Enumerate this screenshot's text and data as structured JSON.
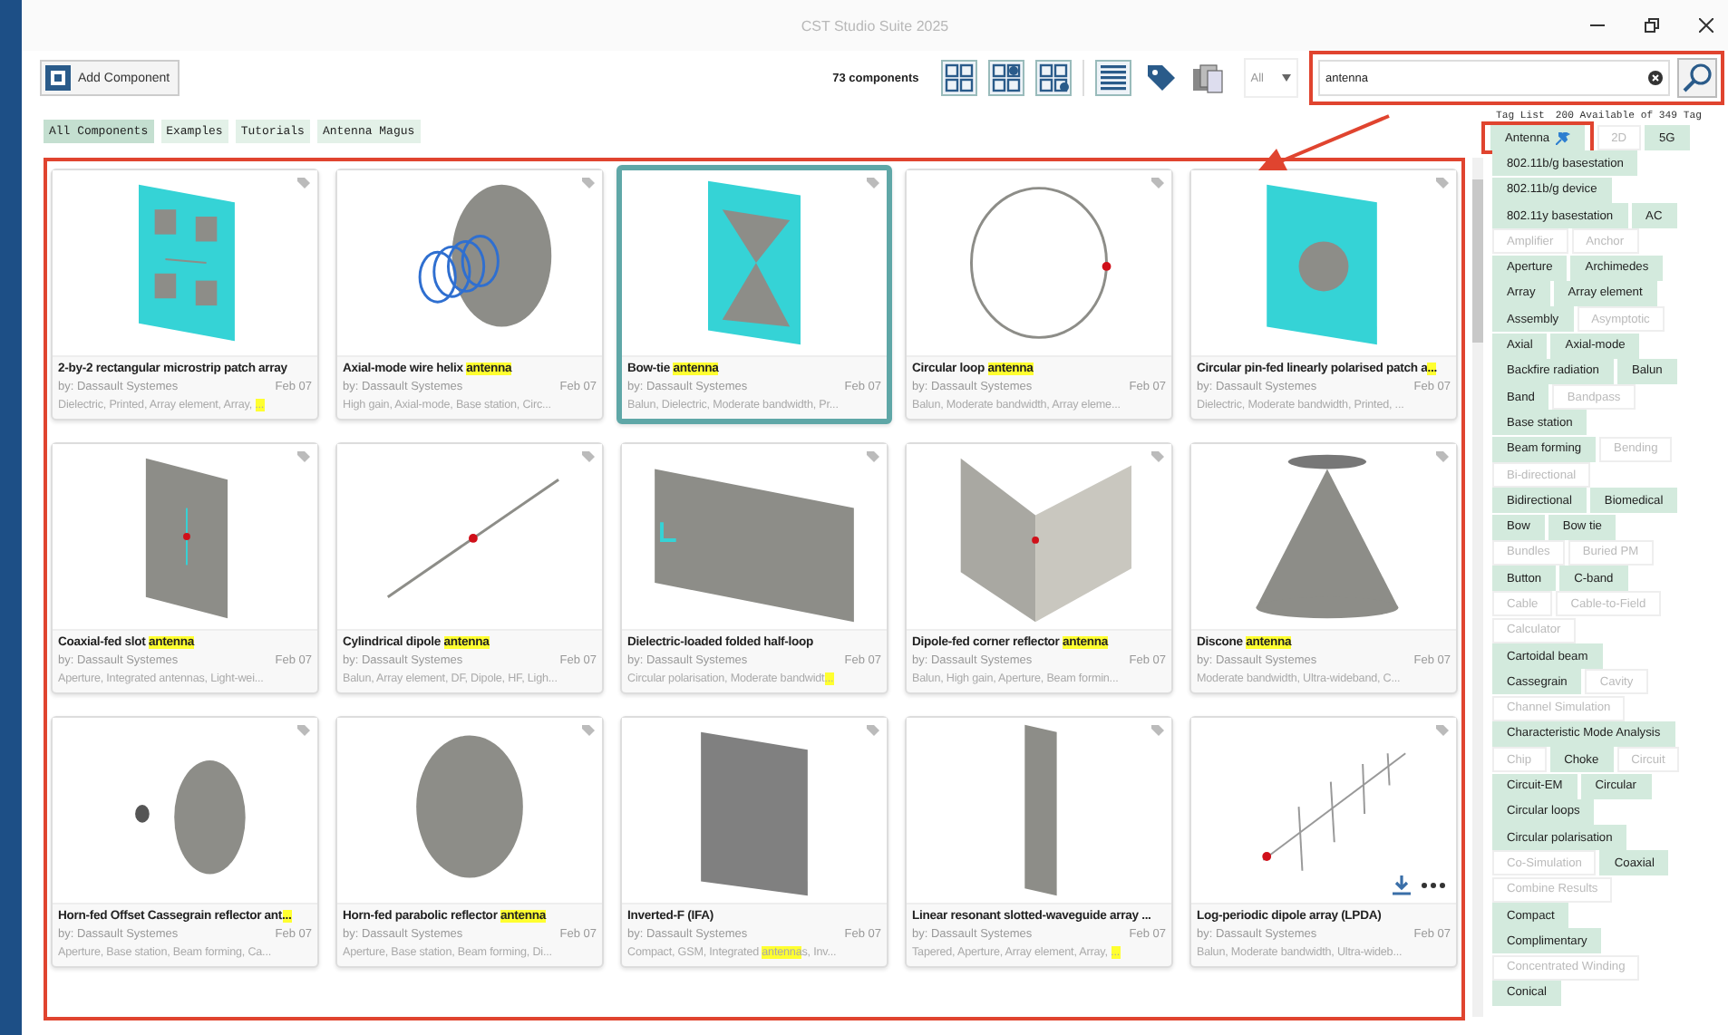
{
  "window": {
    "title": "CST Studio Suite 2025"
  },
  "toolbar": {
    "add_button": "Add Component",
    "count": "73 components",
    "filter": "All",
    "search": {
      "value": "antenna"
    }
  },
  "filters": [
    {
      "label": "All Components",
      "selected": true
    },
    {
      "label": "Examples",
      "selected": false
    },
    {
      "label": "Tutorials",
      "selected": false
    },
    {
      "label": "Antenna Magus",
      "selected": false
    }
  ],
  "cards": [
    {
      "kind": "patch-array",
      "selected": false,
      "hovered": false,
      "title": [
        {
          "text": "2-by-2 rectangular microstrip patch array",
          "highlight": false
        }
      ],
      "author": "by: Dassault Systemes",
      "date": "Feb 07",
      "tags": [
        {
          "text": "Dielectric, Printed, Array element, Array, ",
          "highlight": false
        },
        {
          "text": "...",
          "highlight": true
        }
      ]
    },
    {
      "kind": "helix",
      "selected": false,
      "hovered": false,
      "title": [
        {
          "text": "Axial-mode wire helix ",
          "highlight": false
        },
        {
          "text": "antenna",
          "highlight": true
        }
      ],
      "author": "by: Dassault Systemes",
      "date": "Feb 07",
      "tags": [
        {
          "text": "High gain, Axial-mode, Base station, Circ...",
          "highlight": false
        }
      ]
    },
    {
      "kind": "bowtie",
      "selected": true,
      "hovered": false,
      "title": [
        {
          "text": "Bow-tie ",
          "highlight": false
        },
        {
          "text": "antenna",
          "highlight": true
        }
      ],
      "author": "by: Dassault Systemes",
      "date": "Feb 07",
      "tags": [
        {
          "text": "Balun, Dielectric, Moderate bandwidth, Pr...",
          "highlight": false
        }
      ]
    },
    {
      "kind": "loop",
      "selected": false,
      "hovered": false,
      "title": [
        {
          "text": "Circular loop ",
          "highlight": false
        },
        {
          "text": "antenna",
          "highlight": true
        }
      ],
      "author": "by: Dassault Systemes",
      "date": "Feb 07",
      "tags": [
        {
          "text": "Balun, Moderate bandwidth, Array eleme...",
          "highlight": false
        }
      ]
    },
    {
      "kind": "patch-disc",
      "selected": false,
      "hovered": false,
      "title": [
        {
          "text": "Circular pin-fed linearly polarised patch a",
          "highlight": false
        },
        {
          "text": "...",
          "highlight": true
        }
      ],
      "author": "by: Dassault Systemes",
      "date": "Feb 07",
      "tags": [
        {
          "text": "Dielectric, Moderate bandwidth, Printed, ...",
          "highlight": false
        }
      ]
    },
    {
      "kind": "slot",
      "selected": false,
      "hovered": false,
      "title": [
        {
          "text": "Coaxial-fed slot ",
          "highlight": false
        },
        {
          "text": "antenna",
          "highlight": true
        }
      ],
      "author": "by: Dassault Systemes",
      "date": "Feb 07",
      "tags": [
        {
          "text": "Aperture, Integrated antennas, Light-wei...",
          "highlight": false
        }
      ]
    },
    {
      "kind": "dipole",
      "selected": false,
      "hovered": false,
      "title": [
        {
          "text": "Cylindrical dipole ",
          "highlight": false
        },
        {
          "text": "antenna",
          "highlight": true
        }
      ],
      "author": "by: Dassault Systemes",
      "date": "Feb 07",
      "tags": [
        {
          "text": "Balun, Array element, DF, Dipole, HF, Ligh...",
          "highlight": false
        }
      ]
    },
    {
      "kind": "plate",
      "selected": false,
      "hovered": false,
      "title": [
        {
          "text": "Dielectric-loaded folded half-loop",
          "highlight": false
        }
      ],
      "author": "by: Dassault Systemes",
      "date": "Feb 07",
      "tags": [
        {
          "text": "Circular polarisation, Moderate bandwidt",
          "highlight": false
        },
        {
          "text": "...",
          "highlight": true
        }
      ]
    },
    {
      "kind": "corner",
      "selected": false,
      "hovered": false,
      "title": [
        {
          "text": "Dipole-fed corner reflector ",
          "highlight": false
        },
        {
          "text": "antenna",
          "highlight": true
        }
      ],
      "author": "by: Dassault Systemes",
      "date": "Feb 07",
      "tags": [
        {
          "text": "Balun, High gain, Aperture, Beam formin...",
          "highlight": false
        }
      ]
    },
    {
      "kind": "cone",
      "selected": false,
      "hovered": false,
      "title": [
        {
          "text": "Discone ",
          "highlight": false
        },
        {
          "text": "antenna",
          "highlight": true
        }
      ],
      "author": "by: Dassault Systemes",
      "date": "Feb 07",
      "tags": [
        {
          "text": "Moderate bandwidth, Ultra-wideband, C...",
          "highlight": false
        }
      ]
    },
    {
      "kind": "cassegrain",
      "selected": false,
      "hovered": false,
      "title": [
        {
          "text": "Horn-fed Offset Cassegrain reflector ant",
          "highlight": false
        },
        {
          "text": "...",
          "highlight": true
        }
      ],
      "author": "by: Dassault Systemes",
      "date": "Feb 07",
      "tags": [
        {
          "text": "Aperture, Base station, Beam forming, Ca...",
          "highlight": false
        }
      ]
    },
    {
      "kind": "dish",
      "selected": false,
      "hovered": false,
      "title": [
        {
          "text": "Horn-fed parabolic reflector ",
          "highlight": false
        },
        {
          "text": "antenna",
          "highlight": true
        }
      ],
      "author": "by: Dassault Systemes",
      "date": "Feb 07",
      "tags": [
        {
          "text": "Aperture, Base station, Beam forming, Di...",
          "highlight": false
        }
      ]
    },
    {
      "kind": "panel",
      "selected": false,
      "hovered": false,
      "title": [
        {
          "text": "Inverted-F (IFA)",
          "highlight": false
        }
      ],
      "author": "by: Dassault Systemes",
      "date": "Feb 07",
      "tags": [
        {
          "text": "Compact, GSM, Integrated ",
          "highlight": false
        },
        {
          "text": "antenna",
          "highlight": true
        },
        {
          "text": "s, Inv...",
          "highlight": false
        }
      ]
    },
    {
      "kind": "rod",
      "selected": false,
      "hovered": false,
      "title": [
        {
          "text": "Linear resonant slotted-waveguide array ...",
          "highlight": false
        }
      ],
      "author": "by: Dassault Systemes",
      "date": "Feb 07",
      "tags": [
        {
          "text": "Tapered, Aperture, Array element, Array, ",
          "highlight": false
        },
        {
          "text": "...",
          "highlight": true
        }
      ]
    },
    {
      "kind": "lpda",
      "selected": false,
      "hovered": true,
      "title": [
        {
          "text": "Log-periodic dipole array (LPDA)",
          "highlight": false
        }
      ],
      "author": "by: Dassault Systemes",
      "date": "Feb 07",
      "tags": [
        {
          "text": "Balun, Moderate bandwidth, Ultra-wideb...",
          "highlight": false
        }
      ]
    }
  ],
  "tag_panel": {
    "title": "Tag List",
    "summary": "200 Available of 349 Tag",
    "rows": [
      [
        {
          "label": "Antenna",
          "enabled": true,
          "pinned": true
        },
        {
          "label": "2D",
          "enabled": false,
          "pinned": false
        },
        {
          "label": "5G",
          "enabled": true,
          "pinned": false
        }
      ],
      [
        {
          "label": "802.11b/g basestation",
          "enabled": true,
          "pinned": false
        }
      ],
      [
        {
          "label": "802.11b/g device",
          "enabled": true,
          "pinned": false
        }
      ],
      [
        {
          "label": "802.11y basestation",
          "enabled": true,
          "pinned": false
        },
        {
          "label": "AC",
          "enabled": true,
          "pinned": false
        }
      ],
      [
        {
          "label": "Amplifier",
          "enabled": false,
          "pinned": false
        },
        {
          "label": "Anchor",
          "enabled": false,
          "pinned": false
        }
      ],
      [
        {
          "label": "Aperture",
          "enabled": true,
          "pinned": false
        },
        {
          "label": "Archimedes",
          "enabled": true,
          "pinned": false
        }
      ],
      [
        {
          "label": "Array",
          "enabled": true,
          "pinned": false
        },
        {
          "label": "Array element",
          "enabled": true,
          "pinned": false
        }
      ],
      [
        {
          "label": "Assembly",
          "enabled": true,
          "pinned": false
        },
        {
          "label": "Asymptotic",
          "enabled": false,
          "pinned": false
        }
      ],
      [
        {
          "label": "Axial",
          "enabled": true,
          "pinned": false
        },
        {
          "label": "Axial-mode",
          "enabled": true,
          "pinned": false
        }
      ],
      [
        {
          "label": "Backfire radiation",
          "enabled": true,
          "pinned": false
        },
        {
          "label": "Balun",
          "enabled": true,
          "pinned": false
        }
      ],
      [
        {
          "label": "Band",
          "enabled": true,
          "pinned": false
        },
        {
          "label": "Bandpass",
          "enabled": false,
          "pinned": false
        }
      ],
      [
        {
          "label": "Base station",
          "enabled": true,
          "pinned": false
        }
      ],
      [
        {
          "label": "Beam forming",
          "enabled": true,
          "pinned": false
        },
        {
          "label": "Bending",
          "enabled": false,
          "pinned": false
        }
      ],
      [
        {
          "label": "Bi-directional",
          "enabled": false,
          "pinned": false
        }
      ],
      [
        {
          "label": "Bidirectional",
          "enabled": true,
          "pinned": false
        },
        {
          "label": "Biomedical",
          "enabled": true,
          "pinned": false
        }
      ],
      [
        {
          "label": "Bow",
          "enabled": true,
          "pinned": false
        },
        {
          "label": "Bow tie",
          "enabled": true,
          "pinned": false
        }
      ],
      [
        {
          "label": "Bundles",
          "enabled": false,
          "pinned": false
        },
        {
          "label": "Buried PM",
          "enabled": false,
          "pinned": false
        }
      ],
      [
        {
          "label": "Button",
          "enabled": true,
          "pinned": false
        },
        {
          "label": "C-band",
          "enabled": true,
          "pinned": false
        }
      ],
      [
        {
          "label": "Cable",
          "enabled": false,
          "pinned": false
        },
        {
          "label": "Cable-to-Field",
          "enabled": false,
          "pinned": false
        }
      ],
      [
        {
          "label": "Calculator",
          "enabled": false,
          "pinned": false
        }
      ],
      [
        {
          "label": "Cartoidal beam",
          "enabled": true,
          "pinned": false
        }
      ],
      [
        {
          "label": "Cassegrain",
          "enabled": true,
          "pinned": false
        },
        {
          "label": "Cavity",
          "enabled": false,
          "pinned": false
        }
      ],
      [
        {
          "label": "Channel Simulation",
          "enabled": false,
          "pinned": false
        }
      ],
      [
        {
          "label": "Characteristic Mode Analysis",
          "enabled": true,
          "pinned": false
        }
      ],
      [
        {
          "label": "Chip",
          "enabled": false,
          "pinned": false
        },
        {
          "label": "Choke",
          "enabled": true,
          "pinned": false
        },
        {
          "label": "Circuit",
          "enabled": false,
          "pinned": false
        }
      ],
      [
        {
          "label": "Circuit-EM",
          "enabled": true,
          "pinned": false
        },
        {
          "label": "Circular",
          "enabled": true,
          "pinned": false
        }
      ],
      [
        {
          "label": "Circular loops",
          "enabled": true,
          "pinned": false
        }
      ],
      [
        {
          "label": "Circular polarisation",
          "enabled": true,
          "pinned": false
        }
      ],
      [
        {
          "label": "Co-Simulation",
          "enabled": false,
          "pinned": false
        },
        {
          "label": "Coaxial",
          "enabled": true,
          "pinned": false
        }
      ],
      [
        {
          "label": "Combine Results",
          "enabled": false,
          "pinned": false
        }
      ],
      [
        {
          "label": "Compact",
          "enabled": true,
          "pinned": false
        }
      ],
      [
        {
          "label": "Complimentary",
          "enabled": true,
          "pinned": false
        }
      ],
      [
        {
          "label": "Concentrated Winding",
          "enabled": false,
          "pinned": false
        }
      ],
      [
        {
          "label": "Conical",
          "enabled": true,
          "pinned": false
        }
      ]
    ]
  }
}
